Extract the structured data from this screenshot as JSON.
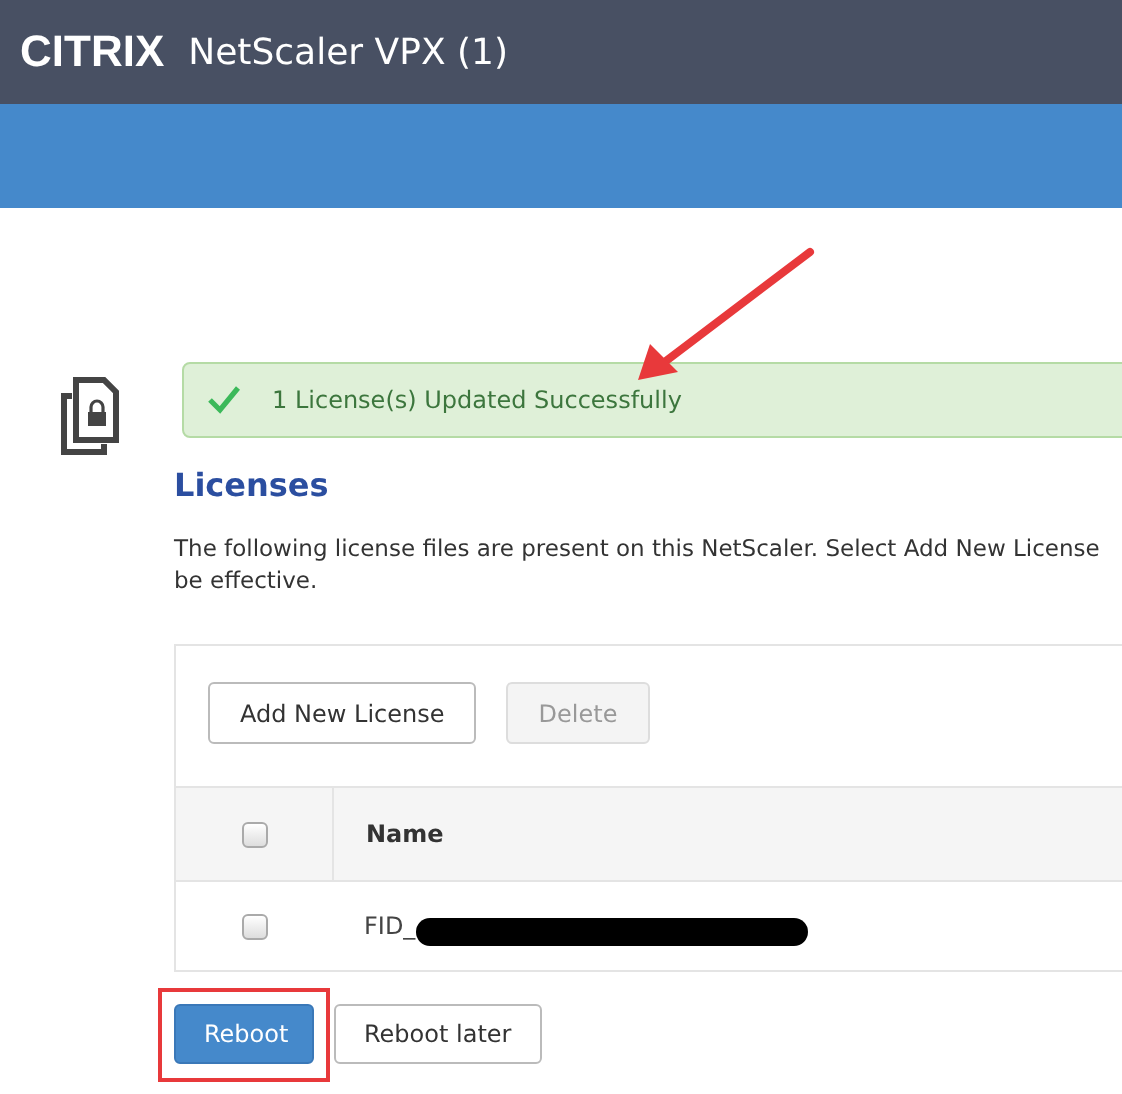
{
  "header": {
    "logo": "CITRIX",
    "title": "NetScaler VPX (1)"
  },
  "alert": {
    "kind": "success",
    "message": "1 License(s) Updated Successfully"
  },
  "section": {
    "title": "Licenses",
    "description_lines": [
      "The following license files are present on this NetScaler. Select Add New License",
      "be effective."
    ]
  },
  "toolbar": [
    {
      "label": "Add New License",
      "disabled": false
    },
    {
      "label": "Delete",
      "disabled": true
    }
  ],
  "table": {
    "header_checked": false,
    "columns": [
      "Name"
    ],
    "rows": [
      {
        "checked": false,
        "name": "FID_"
      }
    ]
  },
  "actions": [
    {
      "label": "Reboot",
      "primary": true
    },
    {
      "label": "Reboot later",
      "primary": false
    }
  ]
}
